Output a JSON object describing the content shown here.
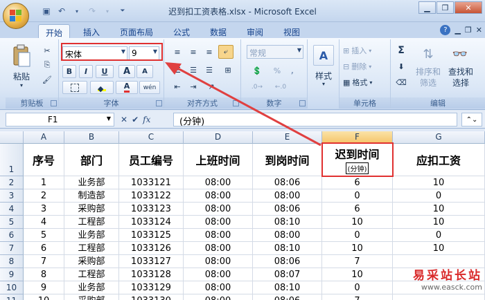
{
  "window": {
    "title": "迟到扣工资表格.xlsx - Microsoft Excel"
  },
  "tabs": [
    "开始",
    "插入",
    "页面布局",
    "公式",
    "数据",
    "审阅",
    "视图"
  ],
  "ribbon": {
    "clipboard": {
      "paste": "粘贴",
      "label": "剪贴板"
    },
    "font": {
      "name": "宋体",
      "size": "9",
      "bold": "B",
      "italic": "I",
      "underline": "U",
      "grow": "A",
      "shrink": "A",
      "wen": "wén",
      "color_a": "A",
      "label": "字体"
    },
    "align": {
      "label": "对齐方式"
    },
    "number": {
      "format": "常规",
      "percent": "%",
      "comma": ",",
      "label": "数字"
    },
    "style": {
      "label": "样式"
    },
    "cells": {
      "insert": "插入",
      "delete": "删除",
      "format": "格式",
      "label": "单元格"
    },
    "edit": {
      "sigma": "Σ",
      "sort": "排序和\n筛选",
      "sort1": "排序和",
      "sort2": "筛选",
      "find1": "查找和",
      "find2": "选择",
      "label": "编辑"
    }
  },
  "formula_bar": {
    "name_box": "F1",
    "fx": "fx",
    "content": "(分钟)"
  },
  "columns": [
    "A",
    "B",
    "C",
    "D",
    "E",
    "F",
    "G"
  ],
  "headers": [
    "序号",
    "部门",
    "员工编号",
    "上班时间",
    "到岗时间",
    "迟到时间",
    "应扣工资"
  ],
  "header_sub": "(分钟)",
  "rows": [
    [
      "1",
      "业务部",
      "1033121",
      "08:00",
      "08:06",
      "6",
      "10"
    ],
    [
      "2",
      "制造部",
      "1033122",
      "08:00",
      "08:00",
      "0",
      "0"
    ],
    [
      "3",
      "采购部",
      "1033123",
      "08:00",
      "08:06",
      "6",
      "10"
    ],
    [
      "4",
      "工程部",
      "1033124",
      "08:00",
      "08:10",
      "10",
      "10"
    ],
    [
      "5",
      "业务部",
      "1033125",
      "08:00",
      "08:00",
      "0",
      "0"
    ],
    [
      "6",
      "工程部",
      "1033126",
      "08:00",
      "08:10",
      "10",
      "10"
    ],
    [
      "7",
      "采购部",
      "1033127",
      "08:00",
      "08:06",
      "7",
      ""
    ],
    [
      "8",
      "工程部",
      "1033128",
      "08:00",
      "08:07",
      "10",
      ""
    ],
    [
      "9",
      "业务部",
      "1033129",
      "08:00",
      "08:10",
      "0",
      ""
    ],
    [
      "10",
      "采购部",
      "1033130",
      "08:00",
      "08:06",
      "7",
      ""
    ]
  ],
  "row_numbers": [
    "1",
    "2",
    "3",
    "4",
    "5",
    "6",
    "7",
    "8",
    "9",
    "10",
    "11"
  ],
  "watermark": {
    "line1": "易采站长站",
    "line2": "www.easck.com"
  }
}
